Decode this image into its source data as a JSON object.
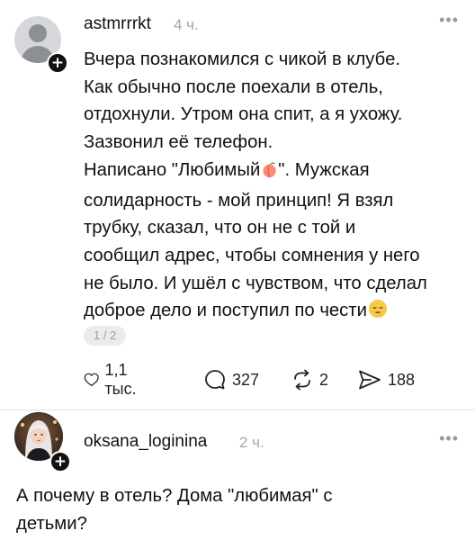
{
  "post": {
    "username": "astmrrrkt",
    "time": "4 ч.",
    "lines": [
      "Вчера познакомился с чикой в клубе.",
      "Как обычно после поехали в отель,",
      "отдохнули. Утром она спит, а я ухожу.",
      "Зазвонил её телефон.",
      "Написано \"Любимый",
      "\". Мужская",
      "солидарность - мой принцип! Я взял",
      "трубку, сказал, что он не с той и",
      "сообщил адрес, чтобы сомнения у него",
      "не было. И ушёл с чувством, что сделал",
      "доброе дело и поступил по чести"
    ],
    "emoji_inline": "peach-emoji",
    "emoji_end": "pensive-face-emoji",
    "pager": "1 / 2",
    "stats": {
      "likes": "1,1 тыс.",
      "comments": "327",
      "reposts": "2",
      "shares": "188"
    }
  },
  "reply": {
    "username": "oksana_loginina",
    "time": "2 ч.",
    "lines": [
      "А почему в отель? Дома \"любимая\" с",
      "детьми?"
    ]
  },
  "icons": [
    "avatar-placeholder-icon",
    "follow-plus-icon",
    "more-options-icon",
    "heart-icon",
    "comment-icon",
    "repost-icon",
    "share-icon"
  ]
}
